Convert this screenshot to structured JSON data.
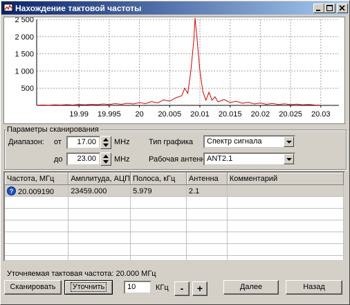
{
  "window": {
    "title": "Нахождение тактовой частоты"
  },
  "chart_data": {
    "type": "line",
    "title": "",
    "xlabel": "",
    "ylabel": "",
    "xlim": [
      19.983,
      20.033
    ],
    "ylim": [
      0,
      2500
    ],
    "x_ticks": [
      "19.99",
      "19.995",
      "20",
      "20.005",
      "20.01",
      "20.015",
      "20.02",
      "20.025",
      "20.03"
    ],
    "y_ticks": [
      "500",
      "1 000",
      "1 500",
      "2 000",
      "2 500"
    ],
    "grid": true,
    "series": [
      {
        "color": "#d40000",
        "x": [
          19.983,
          19.984,
          19.985,
          19.986,
          19.987,
          19.988,
          19.989,
          19.99,
          19.991,
          19.992,
          19.993,
          19.994,
          19.995,
          19.996,
          19.997,
          19.998,
          19.999,
          20.0,
          20.001,
          20.002,
          20.003,
          20.004,
          20.005,
          20.006,
          20.007,
          20.0075,
          20.008,
          20.0085,
          20.009,
          20.0092,
          20.0095,
          20.01,
          20.0105,
          20.011,
          20.0115,
          20.012,
          20.0125,
          20.013,
          20.014,
          20.015,
          20.016,
          20.017,
          20.018,
          20.019,
          20.02,
          20.021,
          20.022,
          20.023,
          20.024,
          20.025,
          20.026,
          20.027,
          20.028,
          20.029,
          20.03
        ],
        "y": [
          5,
          10,
          5,
          15,
          10,
          20,
          10,
          25,
          15,
          30,
          20,
          40,
          25,
          50,
          30,
          60,
          40,
          80,
          50,
          110,
          70,
          160,
          120,
          220,
          280,
          500,
          350,
          1000,
          1900,
          2550,
          2000,
          1000,
          400,
          150,
          380,
          150,
          250,
          100,
          170,
          80,
          120,
          60,
          90,
          40,
          70,
          30,
          55,
          25,
          45,
          20,
          35,
          15,
          25,
          10,
          5
        ]
      }
    ]
  },
  "params": {
    "group_label": "Параметры сканирования",
    "range_label": "Диапазон:",
    "from_label": "от",
    "to_label": "до",
    "from_value": "17.00",
    "to_value": "23.00",
    "unit_mhz": "MHz",
    "graph_type_label": "Тип графика",
    "graph_type_value": "Спектр сигнала",
    "antenna_label": "Рабочая антенна",
    "antenna_value": "ANT2.1"
  },
  "table": {
    "columns": [
      "Частота, МГц",
      "Амплитуда, АЦП",
      "Полоса, кГц",
      "Антенна",
      "Комментарий"
    ],
    "rows": [
      [
        "20.009190",
        "23459.000",
        "5.979",
        "2.1",
        ""
      ]
    ]
  },
  "status": {
    "text": "Уточняемая тактовая частота: 20.000 МГц"
  },
  "footer": {
    "scan_label": "Сканировать",
    "refine_label": "Уточнить",
    "step_value": "10",
    "step_unit": "КГц",
    "minus_label": "-",
    "plus_label": "+",
    "next_label": "Далее",
    "back_label": "Назад"
  }
}
